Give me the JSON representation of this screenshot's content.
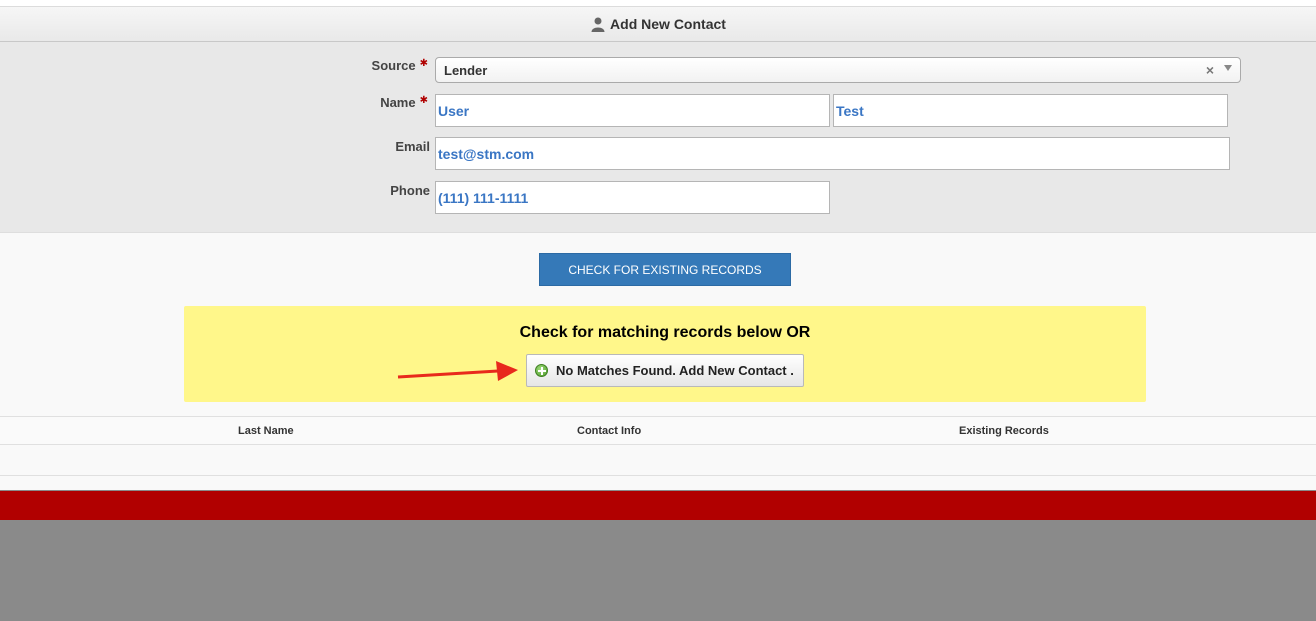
{
  "header": {
    "title": "Add New Contact",
    "icon": "user-icon"
  },
  "form": {
    "source": {
      "label": "Source",
      "required_mark": "✱",
      "value": "Lender",
      "clear": "×"
    },
    "name": {
      "label": "Name",
      "required_mark": "✱",
      "first_value": "User",
      "last_value": "Test"
    },
    "email": {
      "label": "Email",
      "value": "test@stm.com"
    },
    "phone": {
      "label": "Phone",
      "value": "(111) 111-1111"
    }
  },
  "actions": {
    "check_label": "CHECK FOR EXISTING RECORDS"
  },
  "matches": {
    "title": "Check for matching records below OR",
    "add_label": "No Matches Found. Add New Contact ."
  },
  "table": {
    "columns": [
      "Last Name",
      "Contact Info",
      "Existing Records"
    ]
  },
  "colors": {
    "accent": "#3579b8",
    "highlight": "#fff78a",
    "footer_bar": "#b10000",
    "arrow": "#e8291c"
  }
}
